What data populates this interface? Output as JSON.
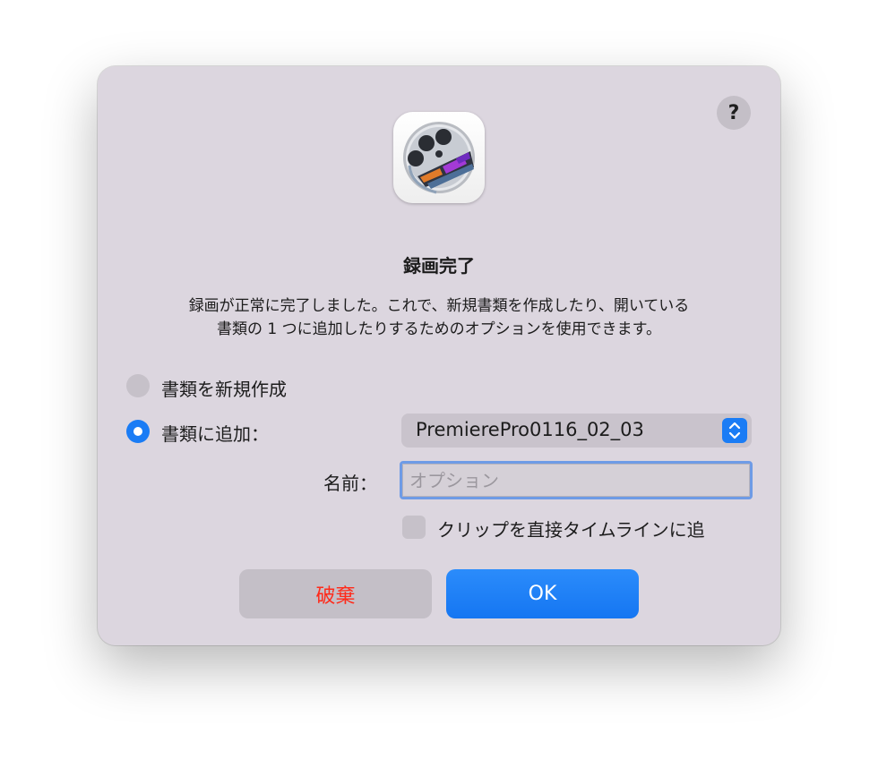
{
  "dialog": {
    "help_label": "?",
    "title": "録画完了",
    "message_line1": "録画が正常に完了しました。これで、新規書類を作成したり、開いている",
    "message_line2": "書類の 1 つに追加したりするためのオプションを使用できます。",
    "option_new_document": "書類を新規作成",
    "option_add_to_document": "書類に追加：",
    "selected_document": "PremierePro0116_02_03",
    "name_label": "名前：",
    "name_placeholder": "オプション",
    "name_value": "",
    "checkbox_label": "クリップを直接タイムラインに追",
    "discard_button": "破棄",
    "ok_button": "OK"
  },
  "state": {
    "selected_option": "add_to_document",
    "add_clips_to_timeline": false
  },
  "colors": {
    "accent": "#1a7cf5",
    "discard_text": "#ff2a1a",
    "dialog_background": "#dcd6df"
  },
  "icons": {
    "app": "screenflow-film-reel-icon",
    "popup": "chevron-up-down-icon"
  }
}
